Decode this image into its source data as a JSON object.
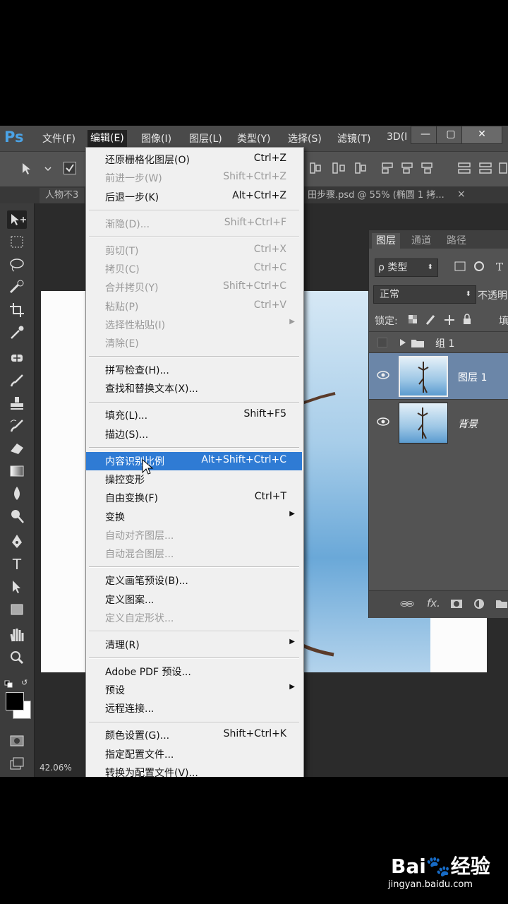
{
  "menubar": {
    "logo": "Ps",
    "items": [
      "文件(F)",
      "编辑(E)",
      "图像(I)",
      "图层(L)",
      "类型(Y)",
      "选择(S)",
      "滤镜(T)",
      "3D(I"
    ],
    "active_index": 1,
    "window_buttons": [
      "—",
      "▢",
      "✕"
    ]
  },
  "tabs": {
    "doc_left": "人物不3",
    "doc_right": "田步骤.psd @ 55% (椭圆 1 拷...",
    "close": "×"
  },
  "status": {
    "zoom": "42.06%"
  },
  "edit_menu": {
    "groups": [
      [
        {
          "label": "还原栅格化图层(O)",
          "shortcut": "Ctrl+Z",
          "disabled": false
        },
        {
          "label": "前进一步(W)",
          "shortcut": "Shift+Ctrl+Z",
          "disabled": true
        },
        {
          "label": "后退一步(K)",
          "shortcut": "Alt+Ctrl+Z",
          "disabled": false
        }
      ],
      [
        {
          "label": "渐隐(D)...",
          "shortcut": "Shift+Ctrl+F",
          "disabled": true
        }
      ],
      [
        {
          "label": "剪切(T)",
          "shortcut": "Ctrl+X",
          "disabled": true
        },
        {
          "label": "拷贝(C)",
          "shortcut": "Ctrl+C",
          "disabled": true
        },
        {
          "label": "合并拷贝(Y)",
          "shortcut": "Shift+Ctrl+C",
          "disabled": true
        },
        {
          "label": "粘贴(P)",
          "shortcut": "Ctrl+V",
          "disabled": true
        },
        {
          "label": "选择性粘贴(I)",
          "shortcut": "",
          "submenu": true,
          "disabled": true
        },
        {
          "label": "清除(E)",
          "shortcut": "",
          "disabled": true
        }
      ],
      [
        {
          "label": "拼写检查(H)...",
          "shortcut": "",
          "disabled": false
        },
        {
          "label": "查找和替换文本(X)...",
          "shortcut": "",
          "disabled": false
        }
      ],
      [
        {
          "label": "填充(L)...",
          "shortcut": "Shift+F5",
          "disabled": false
        },
        {
          "label": "描边(S)...",
          "shortcut": "",
          "disabled": false
        }
      ],
      [
        {
          "label": "内容识别比例",
          "shortcut": "Alt+Shift+Ctrl+C",
          "disabled": false,
          "highlighted": true
        },
        {
          "label": "操控变形",
          "shortcut": "",
          "disabled": false
        },
        {
          "label": "自由变换(F)",
          "shortcut": "Ctrl+T",
          "disabled": false
        },
        {
          "label": "变换",
          "shortcut": "",
          "submenu": true,
          "disabled": false
        },
        {
          "label": "自动对齐图层...",
          "shortcut": "",
          "disabled": true
        },
        {
          "label": "自动混合图层...",
          "shortcut": "",
          "disabled": true
        }
      ],
      [
        {
          "label": "定义画笔预设(B)...",
          "shortcut": "",
          "disabled": false
        },
        {
          "label": "定义图案...",
          "shortcut": "",
          "disabled": false
        },
        {
          "label": "定义自定形状...",
          "shortcut": "",
          "disabled": true
        }
      ],
      [
        {
          "label": "清理(R)",
          "shortcut": "",
          "submenu": true,
          "disabled": false
        }
      ],
      [
        {
          "label": "Adobe PDF 预设...",
          "shortcut": "",
          "disabled": false
        },
        {
          "label": "预设",
          "shortcut": "",
          "submenu": true,
          "disabled": false
        },
        {
          "label": "远程连接...",
          "shortcut": "",
          "disabled": false
        }
      ],
      [
        {
          "label": "颜色设置(G)...",
          "shortcut": "Shift+Ctrl+K",
          "disabled": false
        },
        {
          "label": "指定配置文件...",
          "shortcut": "",
          "disabled": false
        },
        {
          "label": "转换为配置文件(V)...",
          "shortcut": "",
          "disabled": false
        }
      ]
    ]
  },
  "layers_panel": {
    "tabs": [
      "图层",
      "通道",
      "路径"
    ],
    "filter_label": "ρ 类型",
    "blend_mode": "正常",
    "opacity_label": "不透明",
    "lock_label": "锁定:",
    "fill_label": "填",
    "group_name": "组 1",
    "layers": [
      {
        "name": "图层 1",
        "selected": true
      },
      {
        "name": "背景",
        "selected": false
      }
    ],
    "footer_icons": [
      "link-icon",
      "fx-icon",
      "mask-icon",
      "adjustment-icon",
      "folder-icon"
    ],
    "footer_fx": "fx."
  },
  "watermark": {
    "brand": "Bai🐾经验",
    "url": "jingyan.baidu.com"
  }
}
